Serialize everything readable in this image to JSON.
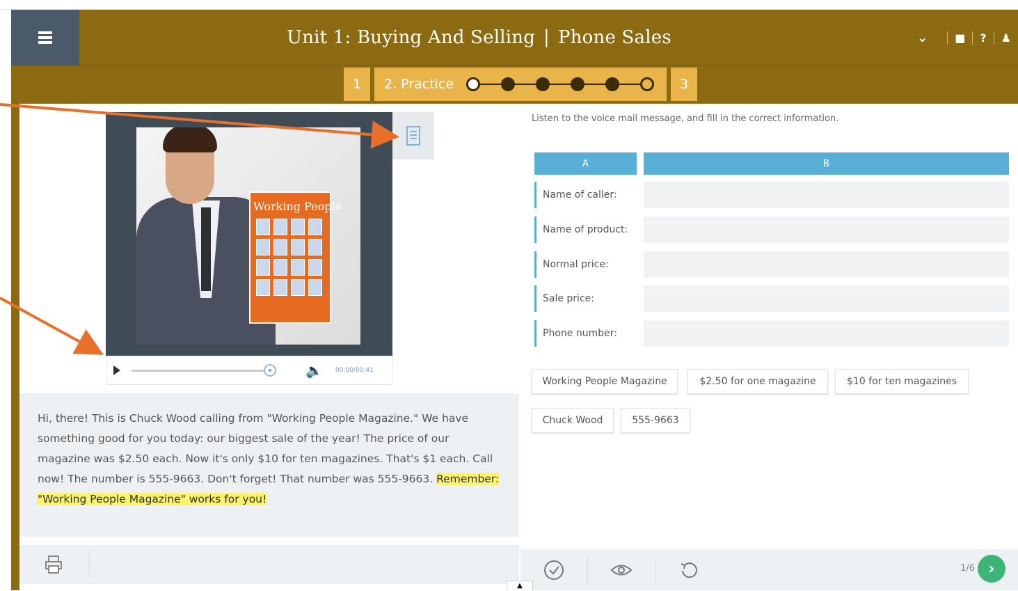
{
  "header": {
    "unit": "Unit 1: Buying And Selling",
    "separator": "|",
    "lesson": "Phone Sales",
    "chevron_icon": "chevron-down-icon",
    "icons": [
      "book-icon",
      "help-icon",
      "user-icon"
    ],
    "help_label": "?"
  },
  "steps": {
    "step1": "1",
    "step2": "2. Practice",
    "step3": "3",
    "progress_total": 6,
    "progress_current": 1
  },
  "player": {
    "time": "00:00/00:41",
    "progress_fraction": 1.0
  },
  "magazine": {
    "title": "Working People"
  },
  "transcript": {
    "text_plain": "Hi, there! This is Chuck Wood calling from \"Working People Magazine.\" We have something good for you today: our biggest sale of the year! The price of our magazine was $2.50 each. Now it's only $10 for ten magazines. That's $1 each. Call now! The number is 555-9663. Don't forget! That number was 555-9663. ",
    "text_highlight": "Remember: \"Working People Magazine\" works for you!"
  },
  "exercise": {
    "instruction": "Listen to the voice mail message, and fill in the correct information.",
    "col_a": "A",
    "col_b": "B",
    "rows": [
      "Name of caller:",
      "Name of product:",
      "Normal price:",
      "Sale price:",
      "Phone number:"
    ],
    "chips": [
      "Working People Magazine",
      "$2.50 for one magazine",
      "$10 for ten magazines",
      "Chuck Wood",
      "555-9663"
    ]
  },
  "footer": {
    "page": "1/6",
    "next_label": "›"
  },
  "colors": {
    "header_bg": "#8c6a12",
    "step_bg": "#e9b54a",
    "table_head": "#5aafd6",
    "highlight": "#fbf36b",
    "next_button": "#3fb477",
    "annotation_arrow": "#e8702a"
  }
}
